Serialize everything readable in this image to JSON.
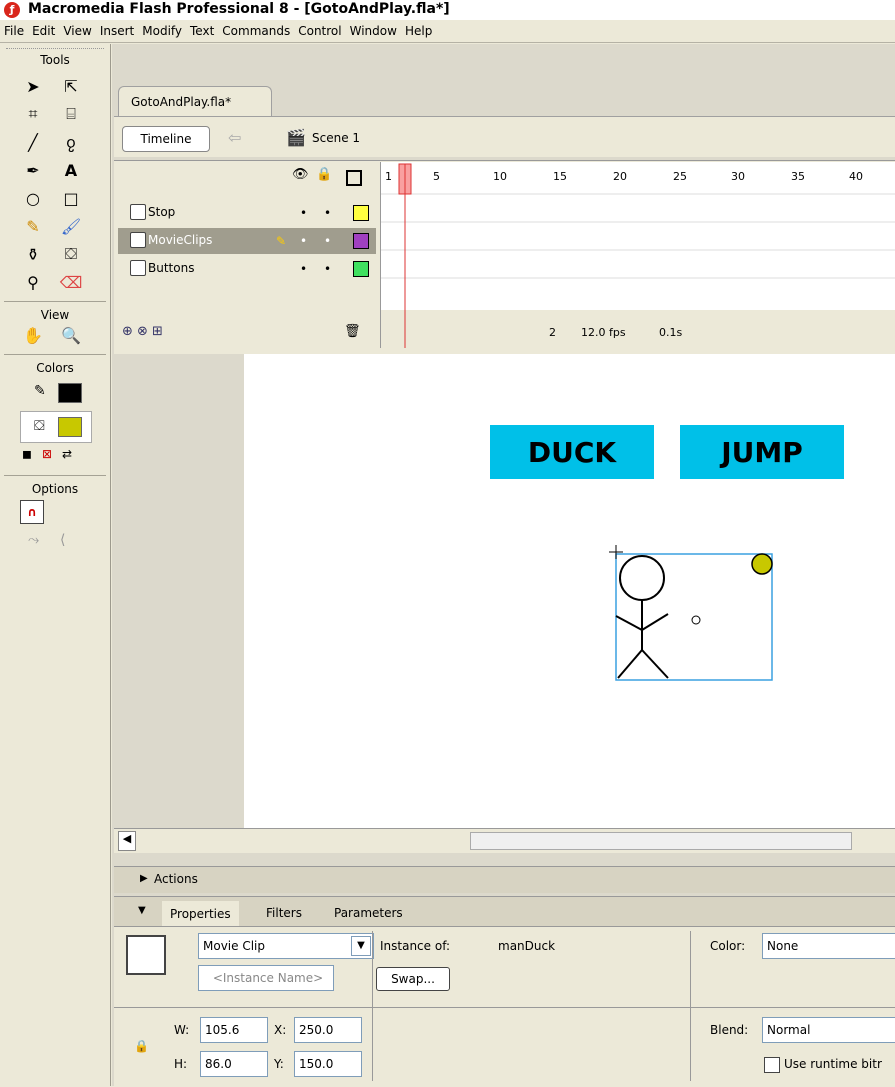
{
  "window": {
    "title": "Macromedia Flash Professional 8 - [GotoAndPlay.fla*]"
  },
  "menu": [
    "File",
    "Edit",
    "View",
    "Insert",
    "Modify",
    "Text",
    "Commands",
    "Control",
    "Window",
    "Help"
  ],
  "tools": {
    "header": "Tools",
    "view_header": "View",
    "colors_header": "Colors",
    "options_header": "Options",
    "stroke_color": "#000000",
    "fill_color": "#c8c800"
  },
  "document": {
    "tab_label": "GotoAndPlay.fla*",
    "timeline_button": "Timeline",
    "scene_label": "Scene 1"
  },
  "timeline": {
    "frame_numbers": [
      "1",
      "5",
      "10",
      "15",
      "20",
      "25",
      "30",
      "35",
      "40"
    ],
    "layers": [
      {
        "name": "Stop",
        "color": "#ffff40",
        "selected": false
      },
      {
        "name": "MovieClips",
        "color": "#a040c0",
        "selected": true
      },
      {
        "name": "Buttons",
        "color": "#40e060",
        "selected": false
      }
    ],
    "current_frame": "2",
    "fps": "12.0 fps",
    "time": "0.1s"
  },
  "stage": {
    "button1": "DUCK",
    "button2": "JUMP",
    "button_color": "#00c0e8"
  },
  "panels": {
    "actions_label": "Actions",
    "tabs": [
      "Properties",
      "Filters",
      "Parameters"
    ]
  },
  "properties": {
    "symbol_type": "Movie Clip",
    "instance_name_placeholder": "<Instance Name>",
    "instance_of_label": "Instance of:",
    "instance_of_value": "manDuck",
    "swap_button": "Swap...",
    "color_label": "Color:",
    "color_value": "None",
    "blend_label": "Blend:",
    "blend_value": "Normal",
    "runtime_bitmap": "Use runtime bitr",
    "w_label": "W:",
    "w_value": "105.6",
    "h_label": "H:",
    "h_value": "86.0",
    "x_label": "X:",
    "x_value": "250.0",
    "y_label": "Y:",
    "y_value": "150.0"
  }
}
